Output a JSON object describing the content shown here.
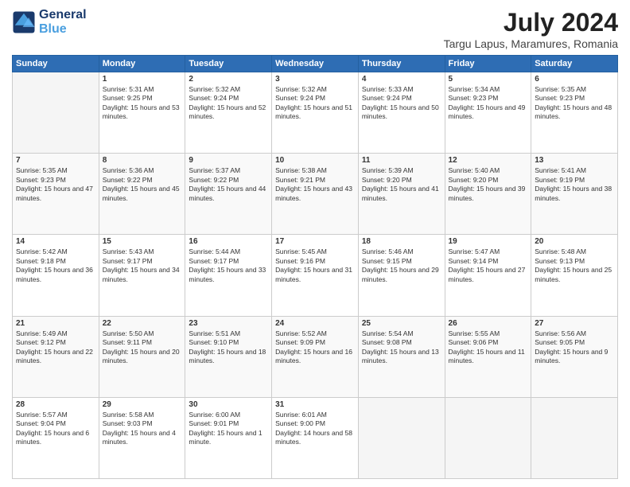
{
  "header": {
    "logo_line1": "General",
    "logo_line2": "Blue",
    "month_year": "July 2024",
    "location": "Targu Lapus, Maramures, Romania"
  },
  "weekdays": [
    "Sunday",
    "Monday",
    "Tuesday",
    "Wednesday",
    "Thursday",
    "Friday",
    "Saturday"
  ],
  "weeks": [
    [
      {
        "day": "",
        "sunrise": "",
        "sunset": "",
        "daylight": ""
      },
      {
        "day": "1",
        "sunrise": "Sunrise: 5:31 AM",
        "sunset": "Sunset: 9:25 PM",
        "daylight": "Daylight: 15 hours and 53 minutes."
      },
      {
        "day": "2",
        "sunrise": "Sunrise: 5:32 AM",
        "sunset": "Sunset: 9:24 PM",
        "daylight": "Daylight: 15 hours and 52 minutes."
      },
      {
        "day": "3",
        "sunrise": "Sunrise: 5:32 AM",
        "sunset": "Sunset: 9:24 PM",
        "daylight": "Daylight: 15 hours and 51 minutes."
      },
      {
        "day": "4",
        "sunrise": "Sunrise: 5:33 AM",
        "sunset": "Sunset: 9:24 PM",
        "daylight": "Daylight: 15 hours and 50 minutes."
      },
      {
        "day": "5",
        "sunrise": "Sunrise: 5:34 AM",
        "sunset": "Sunset: 9:23 PM",
        "daylight": "Daylight: 15 hours and 49 minutes."
      },
      {
        "day": "6",
        "sunrise": "Sunrise: 5:35 AM",
        "sunset": "Sunset: 9:23 PM",
        "daylight": "Daylight: 15 hours and 48 minutes."
      }
    ],
    [
      {
        "day": "7",
        "sunrise": "Sunrise: 5:35 AM",
        "sunset": "Sunset: 9:23 PM",
        "daylight": "Daylight: 15 hours and 47 minutes."
      },
      {
        "day": "8",
        "sunrise": "Sunrise: 5:36 AM",
        "sunset": "Sunset: 9:22 PM",
        "daylight": "Daylight: 15 hours and 45 minutes."
      },
      {
        "day": "9",
        "sunrise": "Sunrise: 5:37 AM",
        "sunset": "Sunset: 9:22 PM",
        "daylight": "Daylight: 15 hours and 44 minutes."
      },
      {
        "day": "10",
        "sunrise": "Sunrise: 5:38 AM",
        "sunset": "Sunset: 9:21 PM",
        "daylight": "Daylight: 15 hours and 43 minutes."
      },
      {
        "day": "11",
        "sunrise": "Sunrise: 5:39 AM",
        "sunset": "Sunset: 9:20 PM",
        "daylight": "Daylight: 15 hours and 41 minutes."
      },
      {
        "day": "12",
        "sunrise": "Sunrise: 5:40 AM",
        "sunset": "Sunset: 9:20 PM",
        "daylight": "Daylight: 15 hours and 39 minutes."
      },
      {
        "day": "13",
        "sunrise": "Sunrise: 5:41 AM",
        "sunset": "Sunset: 9:19 PM",
        "daylight": "Daylight: 15 hours and 38 minutes."
      }
    ],
    [
      {
        "day": "14",
        "sunrise": "Sunrise: 5:42 AM",
        "sunset": "Sunset: 9:18 PM",
        "daylight": "Daylight: 15 hours and 36 minutes."
      },
      {
        "day": "15",
        "sunrise": "Sunrise: 5:43 AM",
        "sunset": "Sunset: 9:17 PM",
        "daylight": "Daylight: 15 hours and 34 minutes."
      },
      {
        "day": "16",
        "sunrise": "Sunrise: 5:44 AM",
        "sunset": "Sunset: 9:17 PM",
        "daylight": "Daylight: 15 hours and 33 minutes."
      },
      {
        "day": "17",
        "sunrise": "Sunrise: 5:45 AM",
        "sunset": "Sunset: 9:16 PM",
        "daylight": "Daylight: 15 hours and 31 minutes."
      },
      {
        "day": "18",
        "sunrise": "Sunrise: 5:46 AM",
        "sunset": "Sunset: 9:15 PM",
        "daylight": "Daylight: 15 hours and 29 minutes."
      },
      {
        "day": "19",
        "sunrise": "Sunrise: 5:47 AM",
        "sunset": "Sunset: 9:14 PM",
        "daylight": "Daylight: 15 hours and 27 minutes."
      },
      {
        "day": "20",
        "sunrise": "Sunrise: 5:48 AM",
        "sunset": "Sunset: 9:13 PM",
        "daylight": "Daylight: 15 hours and 25 minutes."
      }
    ],
    [
      {
        "day": "21",
        "sunrise": "Sunrise: 5:49 AM",
        "sunset": "Sunset: 9:12 PM",
        "daylight": "Daylight: 15 hours and 22 minutes."
      },
      {
        "day": "22",
        "sunrise": "Sunrise: 5:50 AM",
        "sunset": "Sunset: 9:11 PM",
        "daylight": "Daylight: 15 hours and 20 minutes."
      },
      {
        "day": "23",
        "sunrise": "Sunrise: 5:51 AM",
        "sunset": "Sunset: 9:10 PM",
        "daylight": "Daylight: 15 hours and 18 minutes."
      },
      {
        "day": "24",
        "sunrise": "Sunrise: 5:52 AM",
        "sunset": "Sunset: 9:09 PM",
        "daylight": "Daylight: 15 hours and 16 minutes."
      },
      {
        "day": "25",
        "sunrise": "Sunrise: 5:54 AM",
        "sunset": "Sunset: 9:08 PM",
        "daylight": "Daylight: 15 hours and 13 minutes."
      },
      {
        "day": "26",
        "sunrise": "Sunrise: 5:55 AM",
        "sunset": "Sunset: 9:06 PM",
        "daylight": "Daylight: 15 hours and 11 minutes."
      },
      {
        "day": "27",
        "sunrise": "Sunrise: 5:56 AM",
        "sunset": "Sunset: 9:05 PM",
        "daylight": "Daylight: 15 hours and 9 minutes."
      }
    ],
    [
      {
        "day": "28",
        "sunrise": "Sunrise: 5:57 AM",
        "sunset": "Sunset: 9:04 PM",
        "daylight": "Daylight: 15 hours and 6 minutes."
      },
      {
        "day": "29",
        "sunrise": "Sunrise: 5:58 AM",
        "sunset": "Sunset: 9:03 PM",
        "daylight": "Daylight: 15 hours and 4 minutes."
      },
      {
        "day": "30",
        "sunrise": "Sunrise: 6:00 AM",
        "sunset": "Sunset: 9:01 PM",
        "daylight": "Daylight: 15 hours and 1 minute."
      },
      {
        "day": "31",
        "sunrise": "Sunrise: 6:01 AM",
        "sunset": "Sunset: 9:00 PM",
        "daylight": "Daylight: 14 hours and 58 minutes."
      },
      {
        "day": "",
        "sunrise": "",
        "sunset": "",
        "daylight": ""
      },
      {
        "day": "",
        "sunrise": "",
        "sunset": "",
        "daylight": ""
      },
      {
        "day": "",
        "sunrise": "",
        "sunset": "",
        "daylight": ""
      }
    ]
  ]
}
